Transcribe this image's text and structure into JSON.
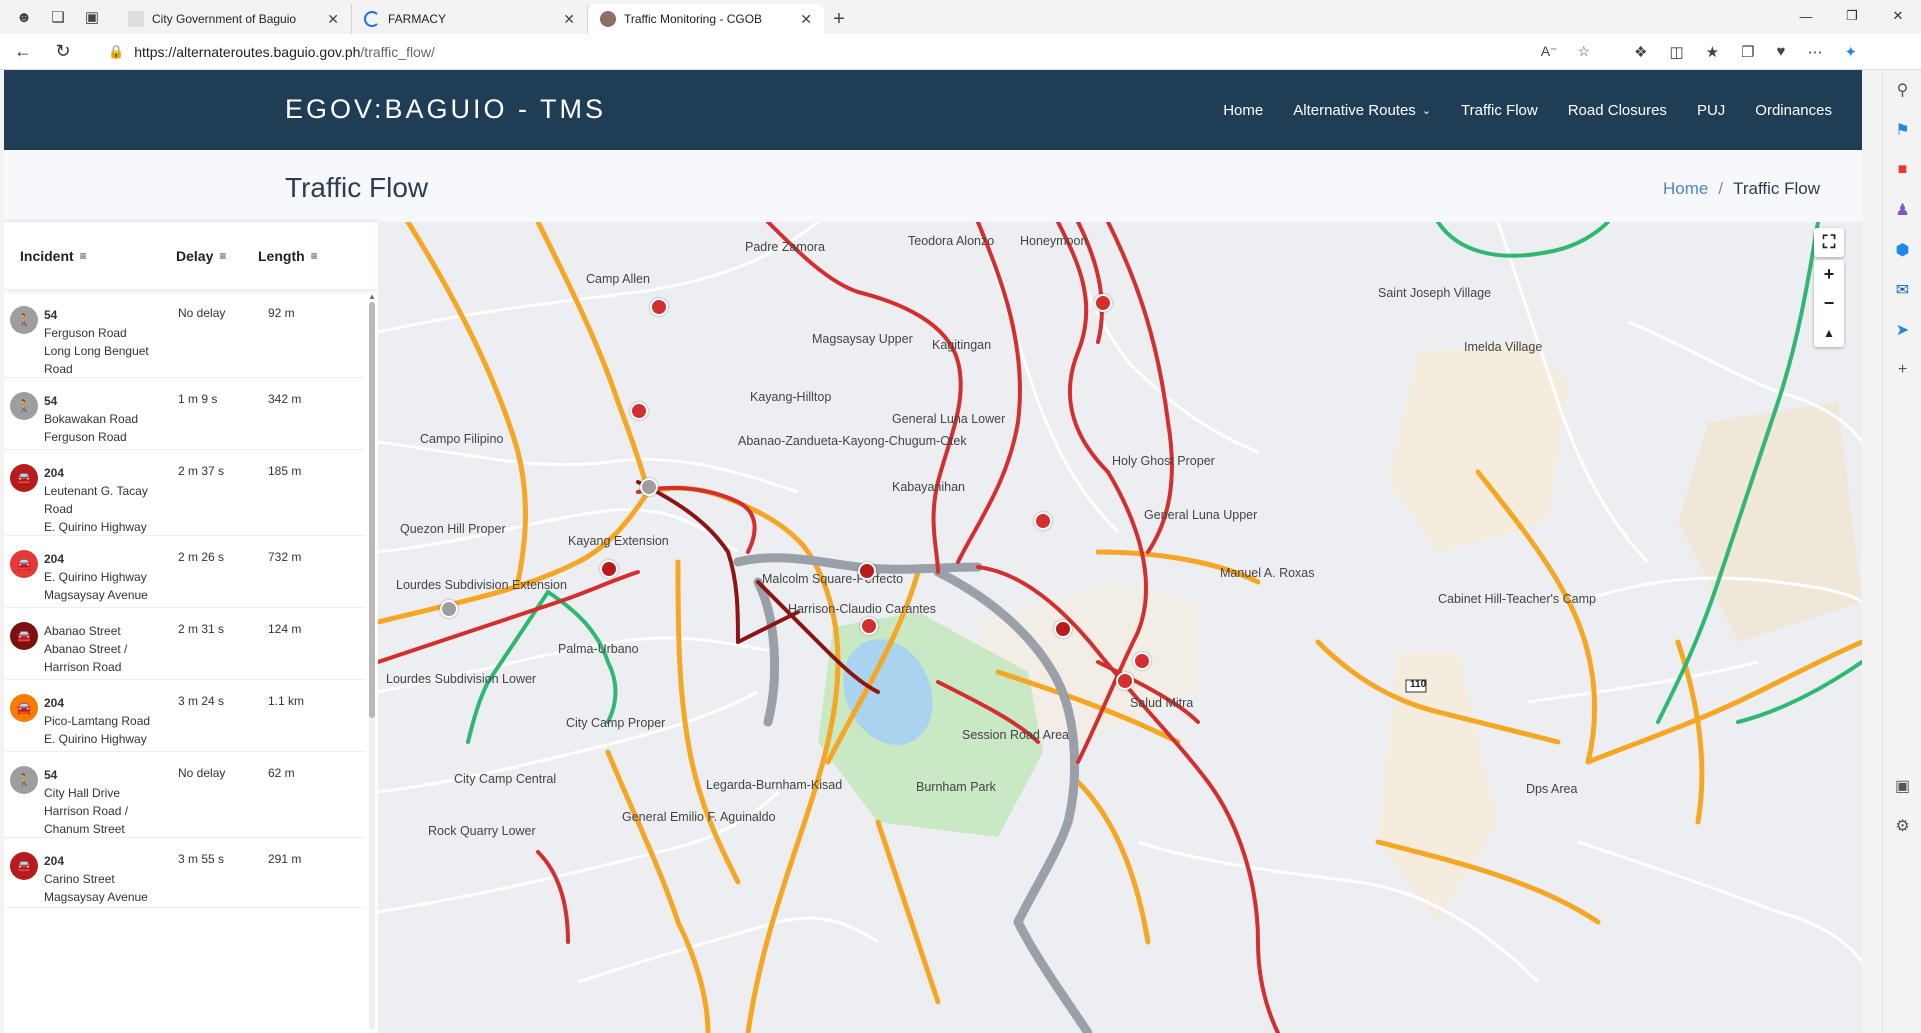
{
  "browser": {
    "tabs": [
      {
        "title": "City Government of Baguio",
        "active": false
      },
      {
        "title": "FARMACY",
        "active": false
      },
      {
        "title": "Traffic Monitoring - CGOB",
        "active": true
      }
    ],
    "url_base": "https://alternateroutes.baguio.gov.ph",
    "url_path": "/traffic_flow/",
    "newtab_icon": "plus-icon"
  },
  "site": {
    "brand": "EGOV:BAGUIO - TMS",
    "menu": [
      "Home",
      "Alternative Routes",
      "Traffic Flow",
      "Road Closures",
      "PUJ",
      "Ordinances"
    ],
    "page_title": "Traffic Flow",
    "breadcrumb": {
      "home": "Home",
      "sep": "/",
      "current": "Traffic Flow"
    }
  },
  "incidents": {
    "headers": {
      "incident": "Incident",
      "delay": "Delay",
      "length": "Length"
    },
    "rows": [
      {
        "code": "54",
        "lines": [
          "Ferguson Road",
          "Long Long Benguet",
          "Road"
        ],
        "delay": "No delay",
        "length": "92 m",
        "color": "#9e9e9e",
        "icon": "pedestrian-icon"
      },
      {
        "code": "54",
        "lines": [
          "Bokawakan Road",
          "Ferguson Road"
        ],
        "delay": "1 m 9 s",
        "length": "342 m",
        "color": "#9e9e9e",
        "icon": "pedestrian-icon"
      },
      {
        "code": "204",
        "lines": [
          "Leutenant G. Tacay",
          "Road",
          "E. Quirino Highway"
        ],
        "delay": "2 m 37 s",
        "length": "185 m",
        "color": "#b71c1c",
        "icon": "car-icon"
      },
      {
        "code": "204",
        "lines": [
          "E. Quirino Highway",
          "Magsaysay Avenue"
        ],
        "delay": "2 m 26 s",
        "length": "732 m",
        "color": "#e53935",
        "icon": "car-icon"
      },
      {
        "code": "",
        "lines": [
          "Abanao Street",
          "Abanao Street /",
          "Harrison Road"
        ],
        "delay": "2 m 31 s",
        "length": "124 m",
        "color": "#7b1010",
        "icon": "car-icon"
      },
      {
        "code": "204",
        "lines": [
          "Pico-Lamtang Road",
          "E. Quirino Highway"
        ],
        "delay": "3 m 24 s",
        "length": "1.1 km",
        "color": "#f57c00",
        "icon": "car-icon"
      },
      {
        "code": "54",
        "lines": [
          "City Hall Drive",
          "Harrison Road /",
          "Chanum Street"
        ],
        "delay": "No delay",
        "length": "62 m",
        "color": "#9e9e9e",
        "icon": "pedestrian-icon"
      },
      {
        "code": "204",
        "lines": [
          "Carino Street",
          "Magsaysay Avenue"
        ],
        "delay": "3 m 55 s",
        "length": "291 m",
        "color": "#b71c1c",
        "icon": "car-icon"
      }
    ]
  },
  "map": {
    "labels": [
      "Padre Zamora",
      "Teodora Alonzo",
      "Honeymoon",
      "Camp Allen",
      "Magsaysay Upper",
      "Kagitingan",
      "Saint Joseph Village",
      "Imelda Village",
      "Kayang-Hilltop",
      "General Luna Lower",
      "Abanao-Zandueta-Kayong-Chugum-Otek",
      "Campo Filipino",
      "Holy Ghost Proper",
      "Kabayanihan",
      "Quezon Hill Proper",
      "Kayang Extension",
      "General Luna Upper",
      "Malcolm Square-Perfecto",
      "Manuel A. Roxas",
      "Lourdes Subdivision Extension",
      "Harrison-Claudio Carantes",
      "Cabinet Hill-Teacher's Camp",
      "Palma-Urbano",
      "Lourdes Subdivision Lower",
      "Salud Mitra",
      "City Camp Proper",
      "Session Road Area",
      "Dps Area",
      "City Camp Central",
      "Legarda-Burnham-Kisad",
      "Burnham Park",
      "Rock Quarry Lower",
      "General Emilio F. Aguinaldo"
    ],
    "route_badge": "110",
    "controls": [
      "fullscreen-icon",
      "zoom-in-icon",
      "zoom-out-icon",
      "compass-icon"
    ]
  }
}
